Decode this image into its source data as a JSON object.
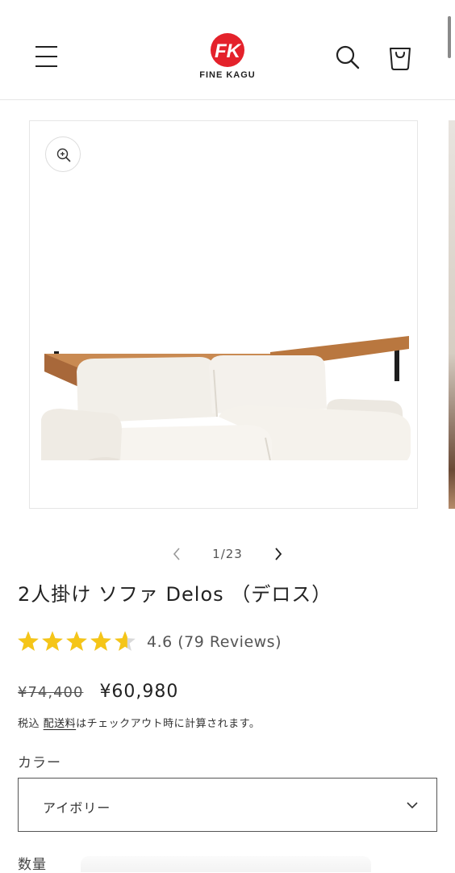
{
  "header": {
    "brand": "FINE KAGU",
    "logo_monogram": "FK",
    "icons": {
      "menu": "hamburger-menu-icon",
      "search": "search-icon",
      "cart": "cart-icon"
    },
    "brand_color": "#e4222b"
  },
  "gallery": {
    "zoom_icon": "zoom-in-icon",
    "counter": "1/23",
    "prev_icon": "chevron-left-icon",
    "next_icon": "chevron-right-icon"
  },
  "product": {
    "title": "2人掛け ソファ Delos （デロス）",
    "rating": {
      "value": 4.6,
      "stars_max": 5,
      "text": "4.6 (79 Reviews)",
      "star_color": "#f5c518"
    },
    "price": {
      "compare_at": "¥74,400",
      "sale": "¥60,980"
    },
    "tax_note": {
      "prefix": "税込 ",
      "link": "配送料",
      "suffix": "はチェックアウト時に計算されます。"
    },
    "color_option": {
      "label": "カラー",
      "selected": "アイボリー"
    },
    "quantity_label": "数量"
  }
}
